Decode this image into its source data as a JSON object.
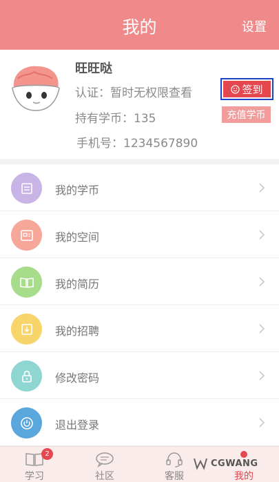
{
  "header": {
    "title": "我的",
    "settings_label": "设置"
  },
  "profile": {
    "name": "旺旺哒",
    "certification": "认证：暂时无权限查看",
    "coins": "持有学币：135",
    "phone": "手机号：1234567890",
    "sign_label": "签到",
    "recharge_label": "充值学币"
  },
  "menu": {
    "items": [
      {
        "label": "我的学币",
        "icon": "coin-book-icon",
        "color": "#c9b4e6"
      },
      {
        "label": "我的空间",
        "icon": "space-icon",
        "color": "#f6a79a"
      },
      {
        "label": "我的简历",
        "icon": "open-book-icon",
        "color": "#a6dc8a"
      },
      {
        "label": "我的招聘",
        "icon": "recruit-icon",
        "color": "#f8d56b"
      },
      {
        "label": "修改密码",
        "icon": "lock-icon",
        "color": "#8fd6d3"
      },
      {
        "label": "退出登录",
        "icon": "power-icon",
        "color": "#5aa7de"
      }
    ]
  },
  "tabbar": {
    "tabs": [
      {
        "label": "学习",
        "badge": "2"
      },
      {
        "label": "社区"
      },
      {
        "label": "客服"
      },
      {
        "label": "我的"
      }
    ]
  },
  "watermark": {
    "text": "CGWANG"
  },
  "colors": {
    "accent": "#f08a8a",
    "sign": "#e5474f",
    "highlight_border": "#1f3fc9"
  }
}
